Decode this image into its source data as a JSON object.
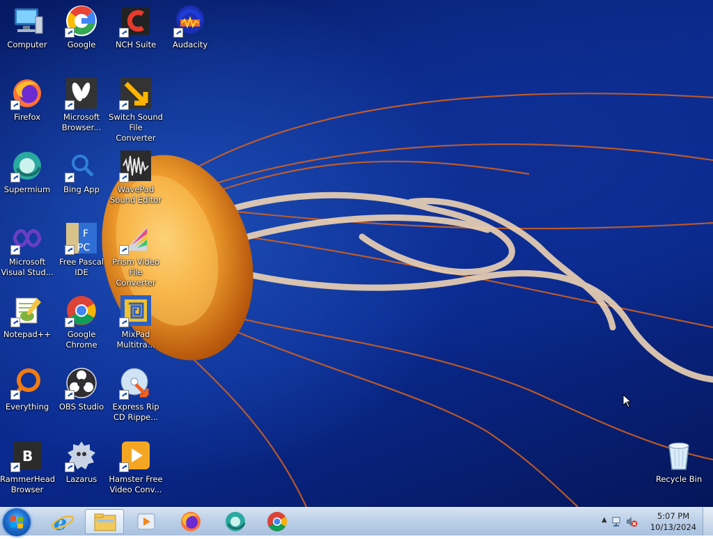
{
  "desktop": {
    "icons": [
      {
        "label": "Computer",
        "name": "computer-icon"
      },
      {
        "label": "Google",
        "name": "google-icon"
      },
      {
        "label": "NCH Suite",
        "name": "nch-suite-icon"
      },
      {
        "label": "Audacity",
        "name": "audacity-icon"
      },
      {
        "label": "Firefox",
        "name": "firefox-icon"
      },
      {
        "label": "Microsoft Browser...",
        "name": "microsoft-browser-icon"
      },
      {
        "label": "Switch Sound File Converter",
        "name": "switch-sound-icon"
      },
      {
        "label": "Supermium",
        "name": "supermium-icon"
      },
      {
        "label": "Bing App",
        "name": "bing-app-icon"
      },
      {
        "label": "WavePad Sound Editor",
        "name": "wavepad-icon"
      },
      {
        "label": "Microsoft Visual Stud...",
        "name": "visual-studio-icon"
      },
      {
        "label": "Free Pascal IDE",
        "name": "free-pascal-icon"
      },
      {
        "label": "Prism Video File Converter",
        "name": "prism-video-icon"
      },
      {
        "label": "Notepad++",
        "name": "notepad-plus-plus-icon"
      },
      {
        "label": "Google Chrome",
        "name": "google-chrome-icon"
      },
      {
        "label": "MixPad Multitra...",
        "name": "mixpad-icon"
      },
      {
        "label": "Everything",
        "name": "everything-icon"
      },
      {
        "label": "OBS Studio",
        "name": "obs-studio-icon"
      },
      {
        "label": "Express Rip CD Rippe...",
        "name": "express-rip-icon"
      },
      {
        "label": "RammerHead Browser",
        "name": "rammerhead-icon"
      },
      {
        "label": "Lazarus",
        "name": "lazarus-icon"
      },
      {
        "label": "Hamster Free Video Conv...",
        "name": "hamster-video-icon"
      },
      {
        "label": "Recycle Bin",
        "name": "recycle-bin-icon"
      }
    ]
  },
  "taskbar": {
    "pinned": [
      {
        "name": "internet-explorer-icon"
      },
      {
        "name": "file-explorer-icon"
      },
      {
        "name": "media-center-icon"
      },
      {
        "name": "firefox-icon"
      },
      {
        "name": "supermium-icon"
      },
      {
        "name": "chrome-icon"
      }
    ],
    "clock": {
      "time": "5:07 PM",
      "date": "10/13/2024"
    }
  }
}
